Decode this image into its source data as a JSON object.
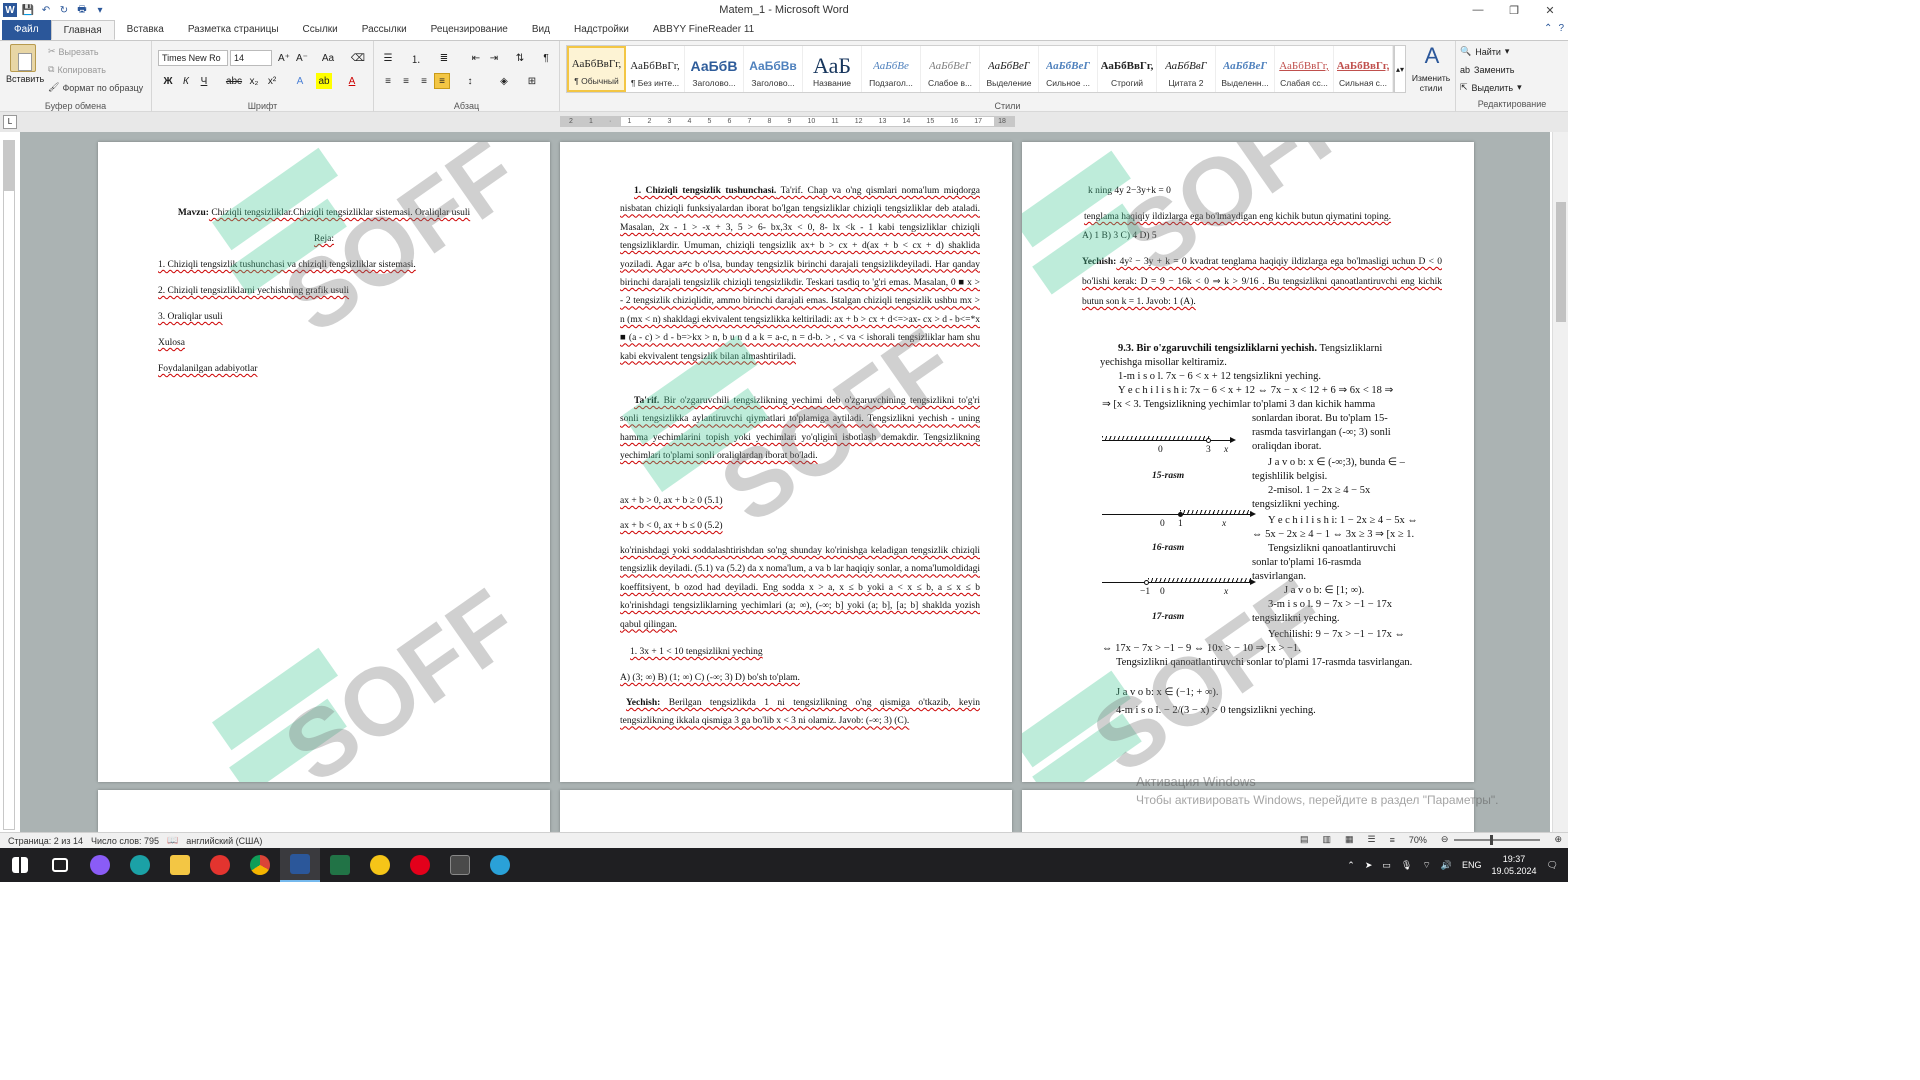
{
  "window": {
    "title": "Matem_1 - Microsoft Word",
    "controls": [
      "—",
      "❐",
      "✕"
    ]
  },
  "tabs": [
    "Файл",
    "Главная",
    "Вставка",
    "Разметка страницы",
    "Ссылки",
    "Рассылки",
    "Рецензирование",
    "Вид",
    "Надстройки",
    "ABBYY FineReader 11"
  ],
  "clipboard": {
    "paste": "Вставить",
    "cut": "Вырезать",
    "copy": "Копировать",
    "format_painter": "Формат по образцу",
    "label": "Буфер обмена"
  },
  "font": {
    "name": "Times New Ro",
    "size": "14",
    "label": "Шрифт"
  },
  "paragraph": {
    "label": "Абзац"
  },
  "styles": {
    "label": "Стили",
    "change": "Изменить стили",
    "items": [
      {
        "sample": "АаБбВвГг,",
        "name": "¶ Обычный"
      },
      {
        "sample": "АаБбВвГг,",
        "name": "¶ Без инте..."
      },
      {
        "sample": "АаБбВ",
        "name": "Заголово..."
      },
      {
        "sample": "АаБбВв",
        "name": "Заголово..."
      },
      {
        "sample": "АаБ",
        "name": "Название"
      },
      {
        "sample": "АаБбВе",
        "name": "Подзагол..."
      },
      {
        "sample": "АаБбВеГ",
        "name": "Слабое в..."
      },
      {
        "sample": "АаБбВеГ",
        "name": "Выделение"
      },
      {
        "sample": "АаБбВеГ",
        "name": "Сильное ..."
      },
      {
        "sample": "АаБбВвГг,",
        "name": "Строгий"
      },
      {
        "sample": "АаБбВвГ",
        "name": "Цитата 2"
      },
      {
        "sample": "АаБбВеГ",
        "name": "Выделенн..."
      },
      {
        "sample": "АаБбВвГг,",
        "name": "Слабая сс..."
      },
      {
        "sample": "АаБбВвГг,",
        "name": "Сильная с..."
      }
    ]
  },
  "editing": {
    "find": "Найти",
    "replace": "Заменить",
    "select": "Выделить",
    "label": "Редактирование"
  },
  "page1": {
    "title_bold": "Mavzu:",
    "title_rest": " Chiziqli tengsizliklar.Chiziqli tengsizliklar sistemasi. Oraliqlar usuli",
    "reja": "Reja:",
    "items": [
      "1. Chiziqli tengsizlik tushunchasi va chiziqli tengsizliklar sistemasi.",
      "2. Chiziqli  tengsizliklarni yechishning grafik  usuli",
      "3. Oraliqlar usuli",
      "Xulosa",
      "Foydalanilgan adabiyotlar"
    ]
  },
  "page2": {
    "h1": "1. Chiziqli tengsizlik tushunchasi.",
    "p1": " Ta'rif. Chap va o'ng qismlari noma'lum miqdorga nisbatan chiziqli funksiyalardan iborat bo'lgan tengsizliklar chiziqli tengsizliklar deb ataladi. Masalan, 2x - 1 > -x + 3, 5 > 6- bx,3x < 0, 8- lx <k - 1 kabi tengsizliklar chiziqli tengsizliklardir. Umuman, chiziqli tengsizlik ax+ b > cx + d(ax + b < cx + d) shaklida yoziladi. Agar a≠c b o'lsa, bunday tengsizlik birinchi darajali tengsizlikdeyiladi. Har qanday birinchi darajali tengsizlik chiziqli tengsizlikdir. Teskari tasdiq to 'g'ri emas. Masalan, 0 ■ x > - 2 tengsizlik chiziqlidir, ammo birinchi darajali emas. Istalgan chiziqli tengsizlik ushbu mx > n (mx < n) shakldagi ekvivalent tengsizlikka keltiriladi: ax + b > cx + d<=>ax- cx > d - b<=*x ■ (a - c) > d - b=>kx > n, b u n d a k = a-c, n = d-b. > , < va < ishorali tengsizliklar ham shu kabi ekvivalent tengsizlik bilan almashtiriladi.",
    "p2_bold": "Ta'rif.",
    "p2": " Bir o'zgaruvchili tengsizlikning yechimi deb o'zgaruvchining tengsizlikni to'g'ri sonli tengsizlikka aylantiruvchi qiymatlari to'plamiga aytiladi. Tengsizlikni yechish - uning hamma yechimlarini topish yoki yechimlari yo'qligini isbotlash demakdir. Tengsizlikning yechimlari to'plami sonli oraliqlardan iborat bo'ladi.",
    "f1": "ax + b > 0, ax + b ≥ 0   (5.1)",
    "f2": "ax + b < 0, ax + b ≤ 0   (5.2)",
    "p3": "ko'rinishdagi yoki soddalashtirishdan so'ng shunday ko'rinishga keladigan tengsizlik chiziqli tengsizlik deyiladi. (5.1) va (5.2) da x noma'lum, a va b lar haqiqiy sonlar, a noma'lumoldidagi koeffitsiyent, b ozod had deyiladi. Eng sodda x > a, x ≤ b yoki a < x ≤ b, a ≤ x ≤ b ko'rinishdagi tengsizliklarning yechimlari (a; ∞), (-∞; b] yoki (a; b], [a; b] shaklda yozish qabul qilingan.",
    "q1": "1. 3x + 1 < 10 tengsizlikni yeching",
    "q1opts": "A) (3; ∞)       B) (1; ∞)      C) (-∞; 3)      D) bo'sh to'plam.",
    "sol_bold": "Yechish:",
    "sol": " Berilgan tengsizlikda 1 ni tengsizlikning o'ng qismiga o'tkazib, keyin tengsizlikning ikkala qismiga 3 ga bo'lib x < 3 ni olamiz. Javob: (-∞; 3) (C)."
  },
  "page3": {
    "l1": "k ning 4y 2−3y+k = 0",
    "l2": "tenglama haqiqiy ildizlarga ega bo'lmaydigan eng kichik butun qiymatini toping.",
    "l3": "A) 1    B) 3   C) 4   D) 5",
    "sol_bold": "Yechish:",
    "sol": " 4y² − 3y + k = 0 kvadrat tenglama haqiqiy ildizlarga ega bo'lmasligi uchun D < 0 bo'lishi kerak: D = 9 − 16k < 0 ⇒ k > 9/16 . Bu tengsizlikni qanoatlantiruvchi eng kichik butun son k = 1. Javob: 1 (A).",
    "h93": "9.3. Bir o'zgaruvchili tengsizliklarni yechish.",
    "h93rest": " Tengsizliklarni yechishga misollar keltiramiz.",
    "m1": "1-m i s o l. 7x − 6 < x + 12 tengsizlikni yeching.",
    "m1y": "Y e c h i l i s h i: 7x − 6 < x + 12 ⇔ 7x − x < 12 + 6 ⇒ 6x < 18 ⇒",
    "m1y2": "⇒ [x < 3. Tengsizlikning yechimlar to'plami 3 dan kichik hamma",
    "m1y3": "sonlardan iborat. Bu to'plam 15-rasmda tasvirlangan (-∞; 3) sonli oraliqdan iborat.",
    "m1j": "J a v o b: x ∈ (-∞;3), bunda ∈ – tegishlilik belgisi.",
    "m2": "2-misol. 1 − 2x ≥ 4 − 5x tengsizlikni yeching.",
    "m2y": "Y e c h i l i s h i: 1 − 2x ≥ 4 − 5x ⇔",
    "m2y2": "⇔ 5x − 2x ≥ 4 − 1 ⇔ 3x ≥ 3 ⇒ [x ≥ 1.",
    "m2y3": "Tengsizlikni qanoatlantiruvchi sonlar to'plami 16-rasmda tasvirlangan.",
    "m2j": "J a v o b: ∈ [1; ∞).",
    "m3": "3-m i s o l.  9 − 7x > −1 − 17x tengsizlikni yeching.",
    "m3y": "Yechilishi: 9 − 7x > −1 − 17x ⇔",
    "m3y2": "⇔ 17x − 7x > −1 − 9 ⇔ 10x > − 10 ⇒ [x > −1.",
    "m3y3": "Tengsizlikni qanoatlantiruvchi sonlar to'plami 17-rasmda tasvirlangan.",
    "m3j": "J a v o b: x ∈ (−1; + ∞).",
    "m4": "4-m i s o l. − 2/(3 − x) > 0 tengsizlikni yeching.",
    "fig15": "15-rasm",
    "fig16": "16-rasm",
    "fig17": "17-rasm",
    "n15": [
      "0",
      "3",
      "x"
    ],
    "n16": [
      "0",
      "1",
      "x"
    ],
    "n17": [
      "−1",
      "0",
      "x"
    ]
  },
  "activation": {
    "line1": "Активация Windows",
    "line2": "Чтобы активировать Windows, перейдите в раздел \"Параметры\"."
  },
  "watermark": "SOFF",
  "status": {
    "page": "Страница: 2 из 14",
    "words": "Число слов: 795",
    "lang": "английский (США)",
    "zoom": "70%"
  },
  "taskbar": {
    "time": "19:37",
    "date": "19.05.2024",
    "lang": "ENG"
  }
}
